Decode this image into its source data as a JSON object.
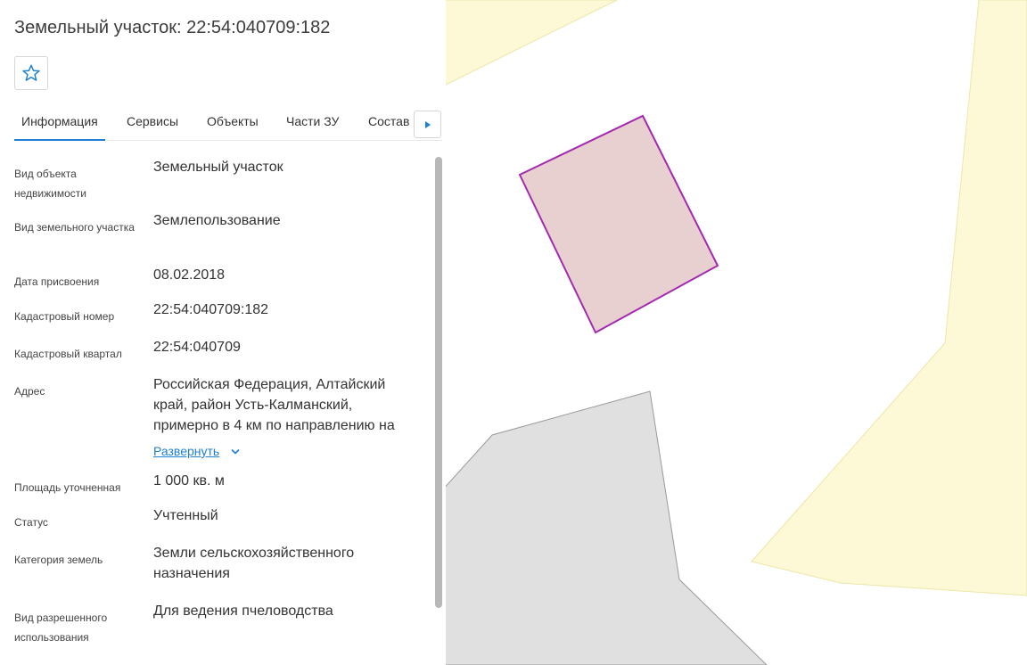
{
  "header": {
    "title": "Земельный участок: 22:54:040709:182",
    "favorite_icon": "star-outline-icon"
  },
  "tabs": [
    {
      "label": "Информация",
      "active": true
    },
    {
      "label": "Сервисы",
      "active": false
    },
    {
      "label": "Объекты",
      "active": false
    },
    {
      "label": "Части ЗУ",
      "active": false
    },
    {
      "label": "Состав",
      "active": false
    }
  ],
  "tabs_next_icon": "caret-right-icon",
  "info": [
    {
      "label": "Вид объекта недвижимости",
      "value": "Земельный участок"
    },
    {
      "label": "Вид земельного участка",
      "value": "Землепользование"
    },
    {
      "label": "Дата присвоения",
      "value": "08.02.2018"
    },
    {
      "label": "Кадастровый номер",
      "value": "22:54:040709:182"
    },
    {
      "label": "Кадастровый квартал",
      "value": "22:54:040709"
    },
    {
      "label": "Адрес",
      "value": "Российская Федерация, Алтайский край, район Усть-Калманский, примерно в 4 км по направлению на"
    },
    {
      "label": "Площадь уточненная",
      "value": "1 000 кв. м"
    },
    {
      "label": "Статус",
      "value": "Учтенный"
    },
    {
      "label": "Категория земель",
      "value": "Земли сельскохозяйственного назначения"
    },
    {
      "label": "Вид разрешенного использования",
      "value": "Для ведения пчеловодства"
    }
  ],
  "address_expand_label": "Развернуть",
  "colors": {
    "accent": "#1f7fd1",
    "parcel_fill": "#e8d0d0",
    "parcel_stroke": "#a32ab0",
    "yellow_area": "#fdf9d6",
    "gray_area": "#e0e0e0"
  }
}
